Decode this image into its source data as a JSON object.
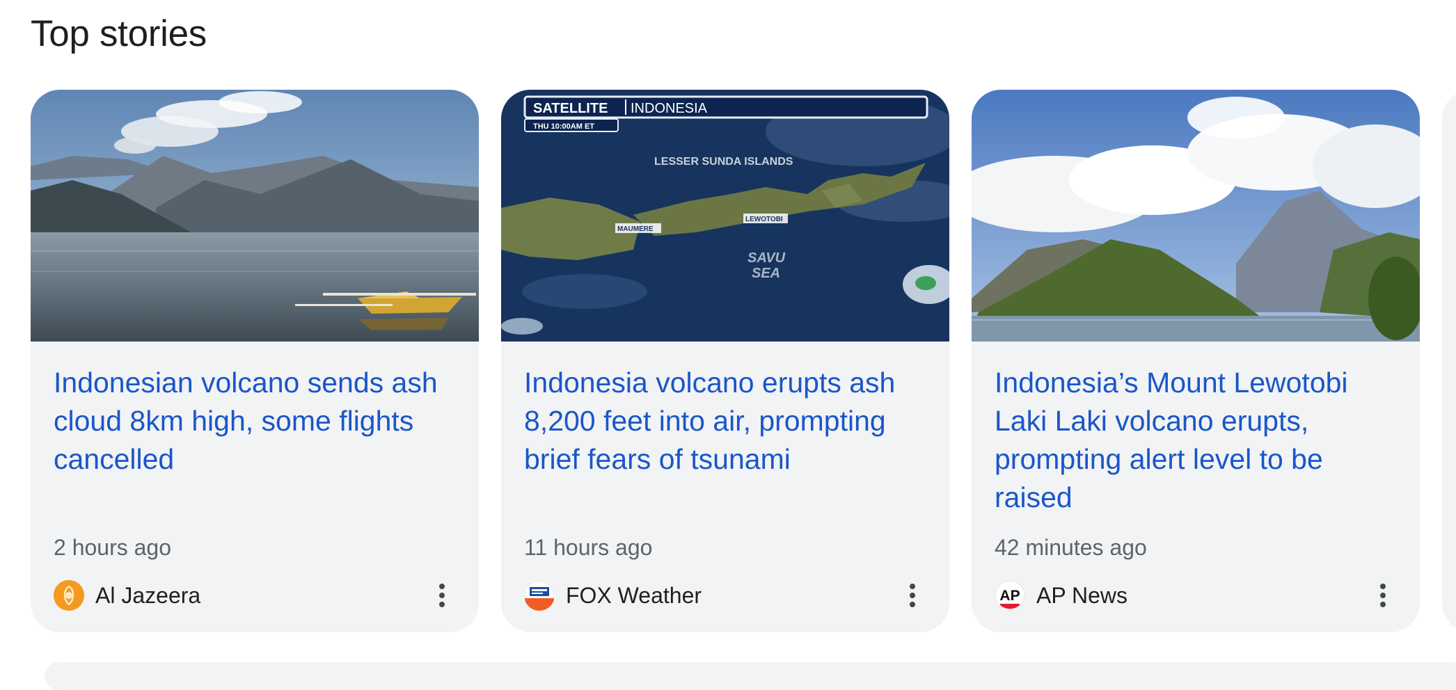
{
  "section": {
    "title": "Top stories"
  },
  "cards": [
    {
      "headline": "Indonesian volcano sends ash cloud 8km high, some flights cancelled",
      "time": "2 hours ago",
      "source": "Al Jazeera",
      "logo_icon": "al-jazeera-logo",
      "image": "volcano-lake-boat-photo"
    },
    {
      "headline": "Indonesia volcano erupts ash 8,200 feet into air, prompting brief fears of tsunami",
      "time": "11 hours ago",
      "source": "FOX Weather",
      "logo_icon": "fox-weather-logo",
      "image": "satellite-map",
      "image_text": {
        "banner_left": "SATELLITE",
        "banner_right": "INDONESIA",
        "banner_sub": "THU 10:00AM ET",
        "region_label": "LESSER SUNDA ISLANDS",
        "city_left": "MAUMERE",
        "city_right": "LEWOTOBI",
        "sea_line1": "SAVU",
        "sea_line2": "SEA"
      }
    },
    {
      "headline": "Indonesia’s Mount Lewotobi Laki Laki volcano erupts, prompting alert level to be raised",
      "time": "42 minutes ago",
      "source": "AP News",
      "logo_icon": "ap-news-logo",
      "logo_text": "AP",
      "image": "volcano-clouds-photo"
    }
  ],
  "colors": {
    "headline": "#1a56c9",
    "card_bg": "#f1f3f4",
    "meta": "#5f6368"
  }
}
